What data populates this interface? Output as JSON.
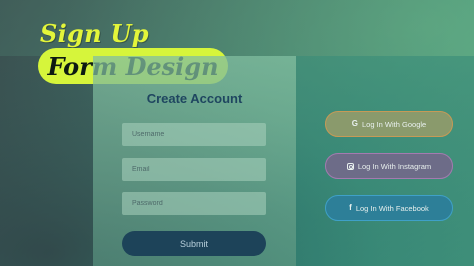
{
  "headline": {
    "line1": "Sign Up",
    "line2": "Form Design"
  },
  "form": {
    "title": "Create Account",
    "fields": [
      {
        "placeholder": "Username"
      },
      {
        "placeholder": "Email"
      },
      {
        "placeholder": "Password"
      }
    ],
    "submit_label": "Submit"
  },
  "social": {
    "google": {
      "label": "Log In With Google",
      "icon": "google-icon"
    },
    "instagram": {
      "label": "Log In With Instagram",
      "icon": "instagram-icon"
    },
    "facebook": {
      "label": "Log In With Facebook",
      "icon": "facebook-icon"
    }
  },
  "colors": {
    "accent": "#d6f53b",
    "submit": "#1d4359",
    "title": "#1f4660"
  }
}
